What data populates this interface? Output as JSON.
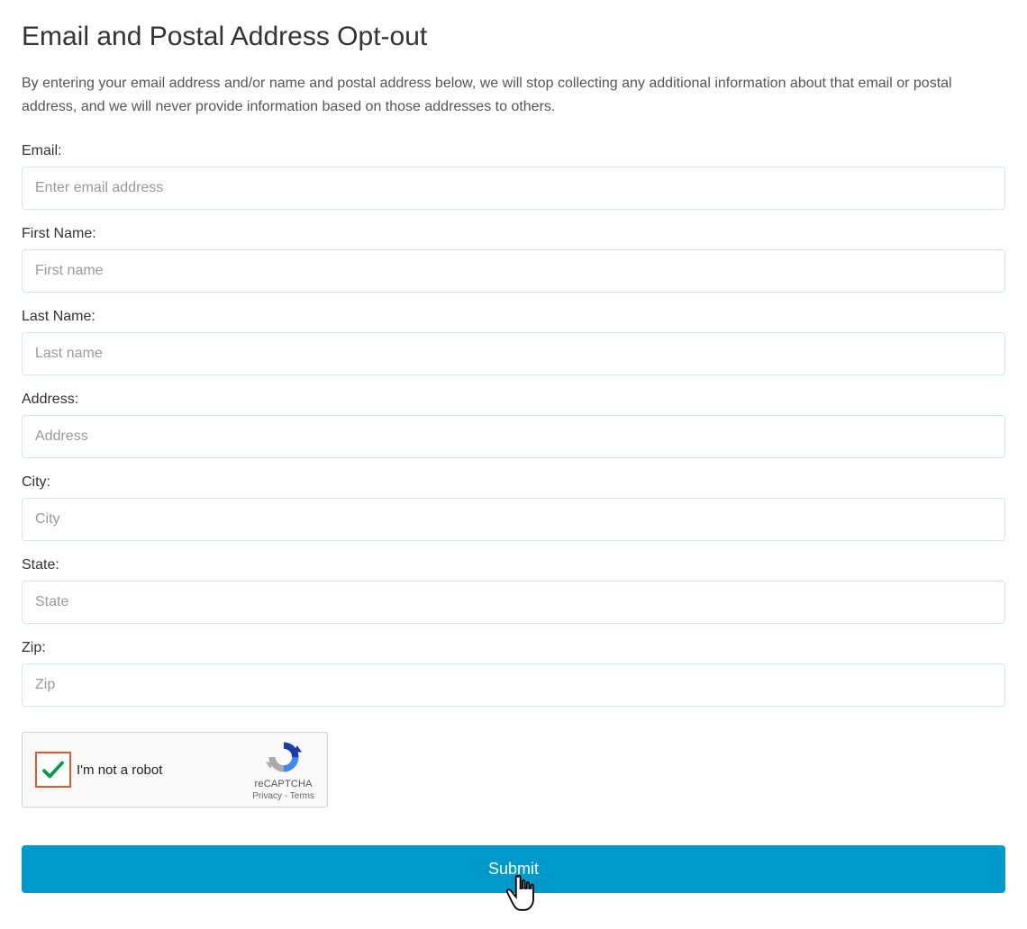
{
  "page": {
    "title": "Email and Postal Address Opt-out",
    "description": "By entering your email address and/or name and postal address below, we will stop collecting any additional information about that email or postal address, and we will never provide information based on those addresses to others."
  },
  "form": {
    "email": {
      "label": "Email:",
      "placeholder": "Enter email address",
      "value": ""
    },
    "first_name": {
      "label": "First Name:",
      "placeholder": "First name",
      "value": ""
    },
    "last_name": {
      "label": "Last Name:",
      "placeholder": "Last name",
      "value": ""
    },
    "address": {
      "label": "Address:",
      "placeholder": "Address",
      "value": ""
    },
    "city": {
      "label": "City:",
      "placeholder": "City",
      "value": ""
    },
    "state": {
      "label": "State:",
      "placeholder": "State",
      "value": ""
    },
    "zip": {
      "label": "Zip:",
      "placeholder": "Zip",
      "value": ""
    }
  },
  "recaptcha": {
    "label": "I'm not a robot",
    "brand": "reCAPTCHA",
    "privacy": "Privacy",
    "separator": " - ",
    "terms": "Terms",
    "checked": true
  },
  "submit": {
    "label": "Submit"
  }
}
